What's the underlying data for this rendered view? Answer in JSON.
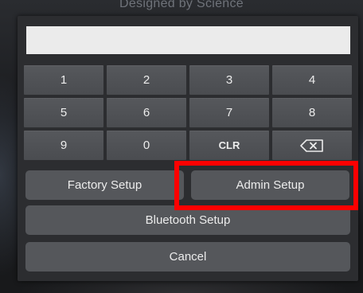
{
  "background": {
    "brand_text": "Designed by Science"
  },
  "pin_input": {
    "value": "",
    "placeholder": ""
  },
  "keypad": {
    "keys": [
      "1",
      "2",
      "3",
      "4",
      "5",
      "6",
      "7",
      "8",
      "9",
      "0",
      "CLR"
    ],
    "backspace_icon": "backspace-icon"
  },
  "buttons": {
    "factory_setup": "Factory Setup",
    "admin_setup": "Admin Setup",
    "bluetooth_setup": "Bluetooth Setup",
    "cancel": "Cancel"
  },
  "colors": {
    "highlight": "#ff0000",
    "dialog": "#2c2d30",
    "key": "#4a4c50",
    "input": "#ebebeb"
  }
}
